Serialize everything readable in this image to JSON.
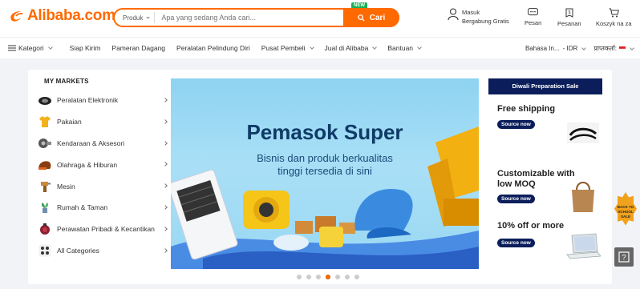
{
  "brand": {
    "name": "Alibaba.com",
    "color": "#ff6a00"
  },
  "search": {
    "type_label": "Produk",
    "placeholder": "Apa yang sedang Anda cari...",
    "button_label": "Cari",
    "new_badge": "NEW"
  },
  "header": {
    "user_line1": "Masuk",
    "user_line2": "Bergabung Gratis",
    "messages": "Pesan",
    "orders": "Pesanan",
    "cart": "Koszyk na za"
  },
  "nav": {
    "categories": "Kategori",
    "items": [
      "Siap Kirim",
      "Pameran Dagang",
      "Peralatan Pelindung Diri",
      "Pusat Pembeli",
      "Jual di Alibaba",
      "Bantuan"
    ],
    "language": "Bahasa In...",
    "currency": "- IDR",
    "ship_to": "प्राप्तकर्ता:"
  },
  "markets": {
    "title": "MY MARKETS",
    "items": [
      {
        "label": "Peralatan Elektronik",
        "icon": "headphones-icon"
      },
      {
        "label": "Pakaian",
        "icon": "shirt-icon"
      },
      {
        "label": "Kendaraan & Aksesori",
        "icon": "car-part-icon"
      },
      {
        "label": "Olahraga & Hiburan",
        "icon": "helmet-icon"
      },
      {
        "label": "Mesin",
        "icon": "drill-icon"
      },
      {
        "label": "Rumah & Taman",
        "icon": "plant-icon"
      },
      {
        "label": "Perawatan Pribadi & Kecantikan",
        "icon": "cosmetics-icon"
      },
      {
        "label": "All Categories",
        "icon": "grid-icon"
      }
    ]
  },
  "banner": {
    "title": "Pemasok Super",
    "subtitle_line1": "Bisnis dan produk berkualitas",
    "subtitle_line2": "tinggi tersedia di sini",
    "dots": 7,
    "active_dot": 4
  },
  "right": {
    "header": "Diwali Preparation Sale",
    "promos": [
      {
        "title_line1": "Free shipping",
        "title_line2": "",
        "button": "Source now",
        "image": "eyelashes-icon"
      },
      {
        "title_line1": "Customizable with",
        "title_line2": "low MOQ",
        "button": "Source now",
        "image": "handbag-icon"
      },
      {
        "title_line1": "10% off or more",
        "title_line2": "",
        "button": "Source now",
        "image": "laptop-icon"
      }
    ]
  },
  "side_badge": {
    "line1": "BACK TO",
    "line2": "SCHOOL",
    "line3": "SALE"
  }
}
